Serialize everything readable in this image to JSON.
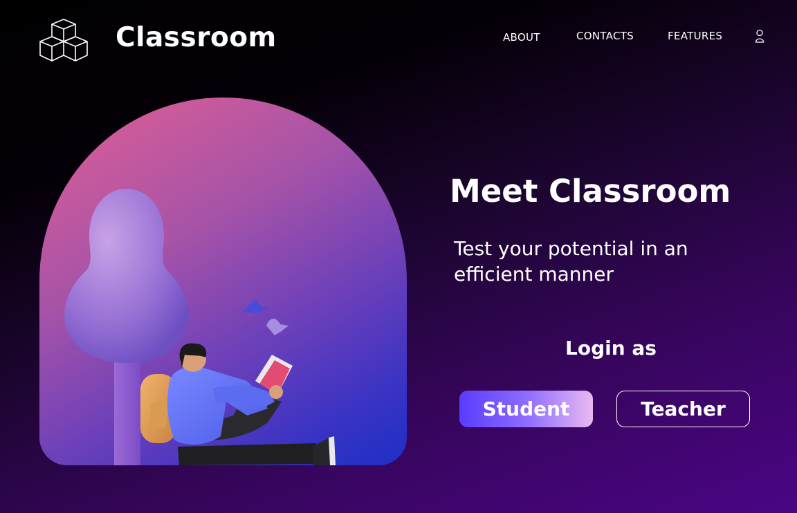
{
  "header": {
    "brand": "Classroom",
    "nav": [
      {
        "label": "ABOUT"
      },
      {
        "label": "CONTACTS"
      },
      {
        "label": "FEATURES"
      }
    ],
    "logo_icon": "stacked-cubes-icon",
    "account_icon": "user-icon"
  },
  "hero": {
    "title": "Meet Classroom",
    "subtitle": "Test your potential in an efficient manner",
    "login_prompt": "Login as",
    "buttons": {
      "student": "Student",
      "teacher": "Teacher"
    },
    "illustration": "student-reading-under-tree"
  },
  "colors": {
    "background_start": "#000000",
    "background_end": "#4b0585",
    "student_button_start": "#5a3cff",
    "student_button_end": "#e9b9f1",
    "arch_top": "#e25f93",
    "arch_bottom": "#1d2fc6"
  }
}
